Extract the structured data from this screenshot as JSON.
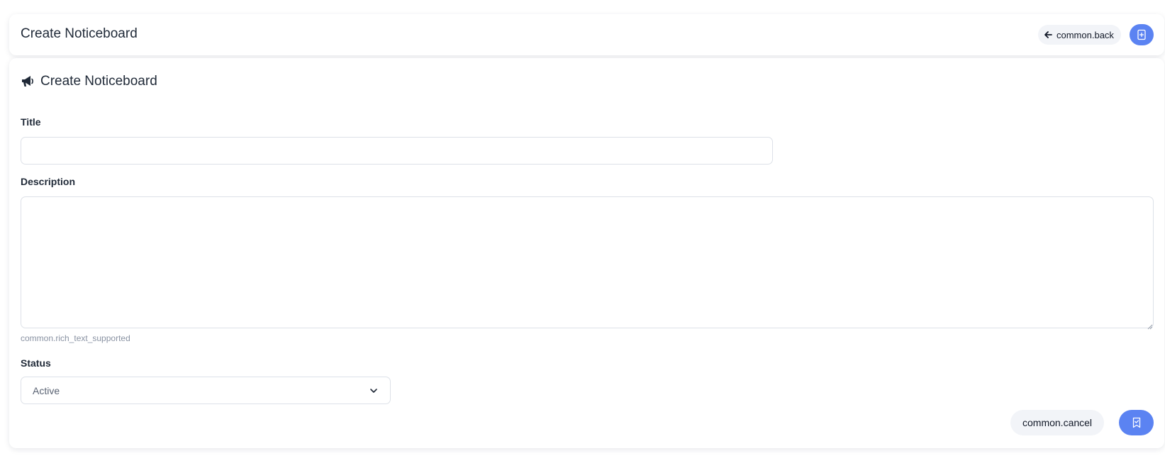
{
  "header": {
    "title": "Create Noticeboard",
    "back_label": "common.back",
    "back_icon": "arrow-left-icon",
    "action_icon": "file-plus-icon"
  },
  "form": {
    "section_title": "Create Noticeboard",
    "section_icon": "megaphone-icon",
    "title_label": "Title",
    "title_value": "",
    "description_label": "Description",
    "description_value": "",
    "description_help": "common.rich_text_supported",
    "status_label": "Status",
    "status_value": "Active",
    "cancel_label": "common.cancel",
    "save_icon": "bookmark-check-icon"
  },
  "colors": {
    "accent": "#5b83f2",
    "muted_button": "#f2f4f8",
    "border": "#dde1e8"
  }
}
